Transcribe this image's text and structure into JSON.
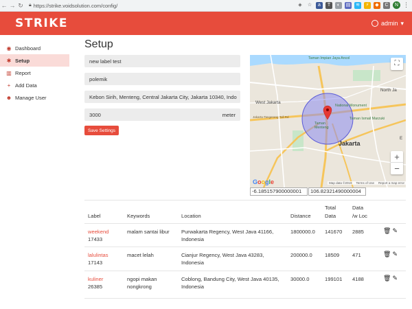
{
  "browser": {
    "url": "https://strike.voidsolution.com/config/",
    "profile_initial": "N"
  },
  "header": {
    "logo": "STRIKE",
    "user_name": "admin",
    "user_caret": "▾"
  },
  "sidebar": {
    "items": [
      {
        "label": "Dashboard",
        "icon": "dashboard-icon",
        "glyph": "◉",
        "active": false
      },
      {
        "label": "Setup",
        "icon": "gear-icon",
        "glyph": "✱",
        "active": true
      },
      {
        "label": "Report",
        "icon": "chart-icon",
        "glyph": "▥",
        "active": false
      },
      {
        "label": "Add Data",
        "icon": "plus-icon",
        "glyph": "+",
        "active": false
      },
      {
        "label": "Manage User",
        "icon": "users-icon",
        "glyph": "☻",
        "active": false
      }
    ]
  },
  "main": {
    "title": "Setup",
    "form": {
      "label_value": "new label test",
      "keywords_value": "polemik",
      "location_value": "Kebon Sirih, Menteng, Central Jakarta City, Jakarta 10340, Indo",
      "distance_value": "3000",
      "distance_unit": "meter",
      "save_label": "Save Settings"
    },
    "map": {
      "labels": {
        "north_jakarta": "North Ja",
        "west_jakarta": "West Jakarta",
        "jakarta": "Jakarta",
        "taman_menteng": "Taman\nMenteng",
        "national_monument": "National Monument",
        "taman_ismail": "Taman Ismail Marzuki",
        "taman_impian": "Taman Impian\nJaya Ancol",
        "east": "E",
        "toll_road": "Jakarta-Tangerang Toll Rd"
      },
      "google": "Google",
      "attribution": [
        "Map data ©2019",
        "Terms of Use",
        "Report a map error"
      ]
    },
    "coordinates": {
      "lat": "-6.185157900000001",
      "lng": "106.82321490000004"
    },
    "table": {
      "headers": {
        "label": "Label",
        "keywords": "Keywords",
        "location": "Location",
        "distance": "Distance",
        "total_data_1": "Total",
        "total_data_2": "Data",
        "data_loc_1": "Data",
        "data_loc_2": "/w Loc"
      },
      "rows": [
        {
          "label": "weekend",
          "id": "17433",
          "keywords": "malam santai libur",
          "location_1": "Purwakarta Regency, West Java 41166,",
          "location_2": "Indonesia",
          "distance": "1800000.0",
          "total": "141670",
          "with_loc": "2885"
        },
        {
          "label": "lalulintas",
          "id": "17143",
          "keywords": "macet lelah",
          "location_1": "Cianjur Regency, West Java 43283,",
          "location_2": "Indonesia",
          "distance": "200000.0",
          "total": "18509",
          "with_loc": "471"
        },
        {
          "label": "kuliner",
          "id": "26385",
          "keywords": "ngopi makan",
          "keywords_2": "nongkrong",
          "location_1": "Coblong, Bandung City, West Java 40135,",
          "location_2": "Indonesia",
          "distance": "30000.0",
          "total": "199101",
          "with_loc": "4188"
        }
      ]
    }
  },
  "colors": {
    "brand": "#e74c3c",
    "sidebar_active": "#fadbd8",
    "radius_fill": "#8c8cf0"
  }
}
